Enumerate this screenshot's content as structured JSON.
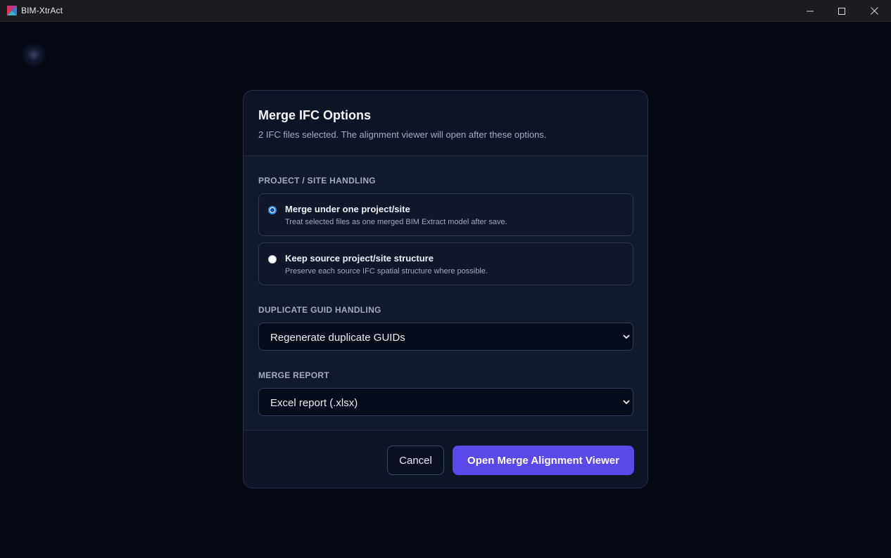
{
  "window": {
    "title": "BIM-XtrAct",
    "logo_icon": "bim-xtract-logo-icon",
    "controls": [
      "minimize-icon",
      "maximize-icon",
      "close-icon"
    ]
  },
  "dialog": {
    "title": "Merge IFC Options",
    "subtitle": "2 IFC files selected. The alignment viewer will open after these options.",
    "project_site": {
      "label": "PROJECT / SITE HANDLING",
      "options": [
        {
          "title": "Merge under one project/site",
          "description": "Treat selected files as one merged BIM Extract model after save.",
          "selected": true
        },
        {
          "title": "Keep source project/site structure",
          "description": "Preserve each source IFC spatial structure where possible.",
          "selected": false
        }
      ]
    },
    "duplicate_guid": {
      "label": "DUPLICATE GUID HANDLING",
      "value": "Regenerate duplicate GUIDs"
    },
    "merge_report": {
      "label": "MERGE REPORT",
      "value": "Excel report (.xlsx)"
    },
    "buttons": {
      "cancel": "Cancel",
      "primary": "Open Merge Alignment Viewer"
    }
  },
  "colors": {
    "background": "#050916",
    "panel": "#0d1424",
    "panel_body": "#111a2c",
    "accent": "#5b48e8",
    "radio_selected": "#2a8ef0"
  }
}
